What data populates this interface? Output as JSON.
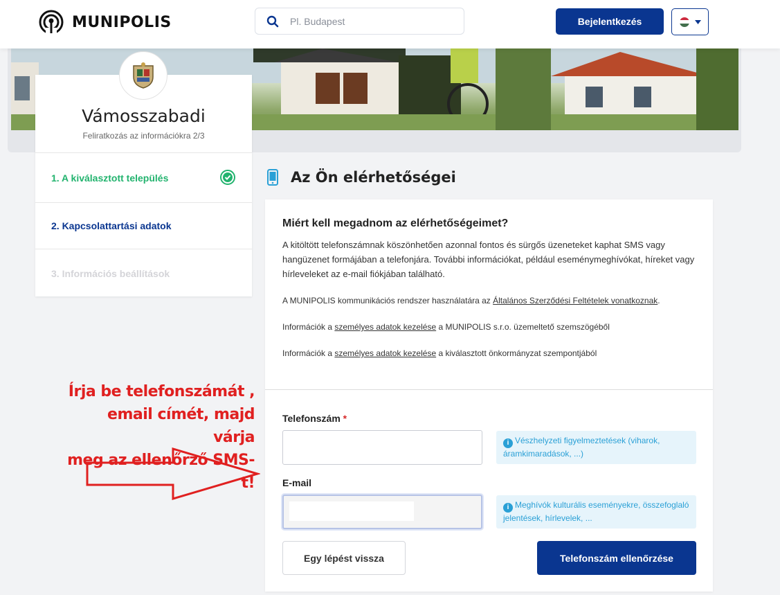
{
  "header": {
    "brand": "MUNIPOLIS",
    "search_placeholder": "Pl. Budapest",
    "login_label": "Bejelentkezés",
    "language": "hu-flag-icon"
  },
  "sidebar": {
    "city_name": "Vámosszabadi",
    "subtitle": "Feliratkozás az információkra 2/3",
    "steps": [
      {
        "label": "1. A kiválasztott település",
        "state": "done"
      },
      {
        "label": "2. Kapcsolattartási adatok",
        "state": "active"
      },
      {
        "label": "3. Információs beállítások",
        "state": "disabled"
      }
    ]
  },
  "main": {
    "section_title": "Az Ön elérhetőségei",
    "info_title": "Miért kell megadnom az elérhetőségeimet?",
    "info_text": "A kitöltött telefonszámnak köszönhetően azonnal fontos és sürgős üzeneteket kaphat SMS vagy hangüzenet formájában a telefonjára. További információkat, például eseménymeghívókat, híreket vagy hírleveleket az e-mail fiókjában található.",
    "terms_prefix": "A MUNIPOLIS kommunikációs rendszer használatára az ",
    "terms_link": "Általános Szerződési Feltételek vonatkoznak",
    "terms_suffix": ".",
    "privacy1_prefix": "Információk a ",
    "privacy1_link": "személyes adatok kezelése",
    "privacy1_suffix": " a MUNIPOLIS s.r.o. üzemeltető szemszögéből",
    "privacy2_prefix": "Információk a ",
    "privacy2_link": "személyes adatok kezelése",
    "privacy2_suffix": " a kiválasztott önkormányzat szempontjából",
    "phone_label": "Telefonszám",
    "phone_required": "*",
    "phone_value": "",
    "phone_hint": "Vészhelyzeti figyelmeztetések (viharok, áramkimaradások, ...)",
    "email_label": "E-mail",
    "email_value": "",
    "email_hint": "Meghívók kulturális eseményekre, összefoglaló jelentések, hírlevelek, ...",
    "back_label": "Egy lépést vissza",
    "verify_label": "Telefonszám ellenőrzése"
  },
  "annotation": {
    "line1": "Írja be telefonszámát ,",
    "line2": "email címét, majd várja",
    "line3": "meg az ellenőrző SMS-t!"
  },
  "colors": {
    "primary": "#0a3690",
    "success": "#22b36e",
    "hint_bg": "#e6f4fb",
    "hint_text": "#2aa0d6",
    "annotation": "#e02020"
  }
}
